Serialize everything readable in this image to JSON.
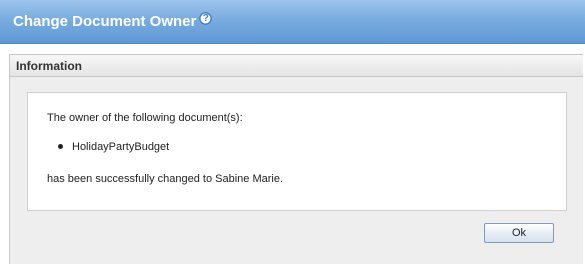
{
  "dialog": {
    "title": "Change Document Owner",
    "help_icon_glyph": "?",
    "help_icon": "help-icon"
  },
  "panel": {
    "title": "Information",
    "message_intro": "The owner of the following document(s):",
    "documents": [
      "HolidayPartyBudget"
    ],
    "message_result": "has been successfully changed to Sabine Marie."
  },
  "buttons": {
    "ok_label": "Ok"
  },
  "colors": {
    "titlebar": "#79acdf",
    "panel_bg": "#eeeeee"
  }
}
